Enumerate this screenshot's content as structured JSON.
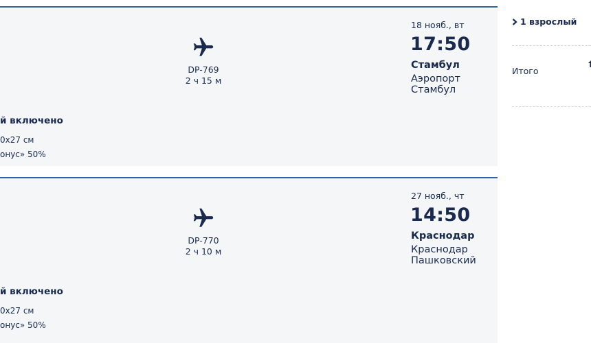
{
  "flights": [
    {
      "flight_number": "DP-769",
      "duration": "2 ч 15 м",
      "arrival_date": "18 нояб., вт",
      "arrival_time": "17:50",
      "arrival_city": "Стамбул",
      "arrival_airport_line1": "Аэропорт",
      "arrival_airport_line2": "Стамбул",
      "baggage_title": "й включено",
      "baggage_size": "0x27 см",
      "baggage_bonus": "онус» 50%"
    },
    {
      "flight_number": "DP-770",
      "duration": "2 ч 10 м",
      "arrival_date": "27 нояб., чт",
      "arrival_time": "14:50",
      "arrival_city": "Краснодар",
      "arrival_airport_line1": "Краснодар",
      "arrival_airport_line2": "Пашковский",
      "baggage_title": "й включено",
      "baggage_size": "0x27 см",
      "baggage_bonus": "онус» 50%"
    }
  ],
  "sidebar": {
    "passengers_label": "1 взрослый",
    "total_label": "Итого"
  },
  "icons": {
    "plane": "airplane-icon",
    "chevron": "chevron-right-icon"
  },
  "colors": {
    "primary_text": "#1a2a4f",
    "card_background": "#f4f6f8",
    "card_border": "#2f63a8"
  }
}
